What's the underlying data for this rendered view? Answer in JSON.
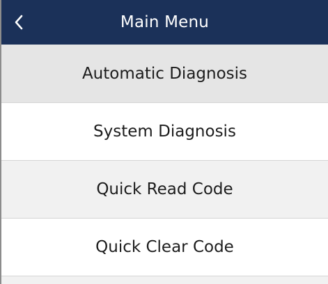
{
  "header": {
    "title": "Main Menu",
    "back_icon": "chevron-left-icon",
    "background": "#1b3159"
  },
  "menu": {
    "items": [
      {
        "label": "Automatic Diagnosis"
      },
      {
        "label": "System Diagnosis"
      },
      {
        "label": "Quick Read Code"
      },
      {
        "label": "Quick Clear Code"
      }
    ]
  }
}
